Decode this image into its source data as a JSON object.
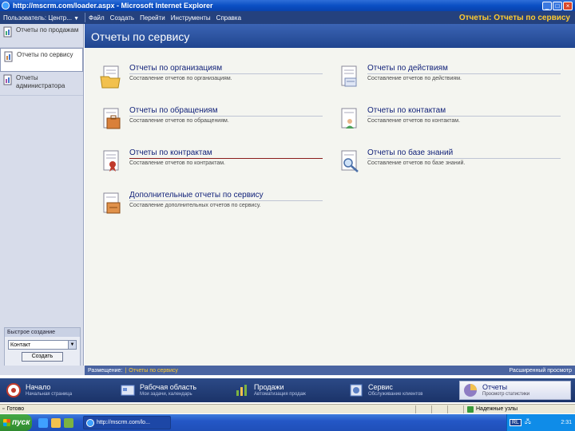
{
  "window": {
    "title": "http://mscrm.com/loader.aspx - Microsoft Internet Explorer",
    "btn_min": "_",
    "btn_max": "□",
    "btn_close": "×"
  },
  "appbar": {
    "user": "Пользователь: Центр...",
    "menu": [
      "Файл",
      "Создать",
      "Перейти",
      "Инструменты",
      "Справка"
    ],
    "section_title": "Отчеты: Отчеты по сервису"
  },
  "leftnav": {
    "items": [
      {
        "label": "Отчеты по продажам",
        "active": false
      },
      {
        "label": "Отчеты по сервису",
        "active": true
      },
      {
        "label": "Отчеты администратора",
        "active": false
      }
    ],
    "quick_create": {
      "title": "Быстрое создание",
      "selected": "Контакт",
      "button": "Создать"
    }
  },
  "main": {
    "header": "Отчеты по сервису",
    "reports": [
      {
        "title": "Отчеты по организациям",
        "desc": "Составление отчетов по организациям.",
        "hot": false
      },
      {
        "title": "Отчеты по действиям",
        "desc": "Составление отчетов по действиям.",
        "hot": false
      },
      {
        "title": "Отчеты по обращениям",
        "desc": "Составление отчетов по обращениям.",
        "hot": false
      },
      {
        "title": "Отчеты по контактам",
        "desc": "Составление отчетов по контактам.",
        "hot": false
      },
      {
        "title": "Отчеты по контрактам",
        "desc": "Составление отчетов по контрактам.",
        "hot": true
      },
      {
        "title": "Отчеты по базе знаний",
        "desc": "Составление отчетов по базе знаний.",
        "hot": false
      },
      {
        "title": "Дополнительные отчеты по сервису",
        "desc": "Составление дополнительных отчетов по сервису.",
        "hot": false
      }
    ]
  },
  "strip": {
    "location_label": "Размещение:",
    "separator": "|",
    "location_value": "Отчеты по сервису",
    "advanced": "Расширенный просмотр"
  },
  "modules": [
    {
      "title": "Начало",
      "sub": "Начальная страница",
      "active": false,
      "color": "#c0392b"
    },
    {
      "title": "Рабочая область",
      "sub": "Мои задачи, календарь",
      "active": false,
      "color": "#6c8fd6"
    },
    {
      "title": "Продажи",
      "sub": "Автоматизация продаж",
      "active": false,
      "color": "#7cb342"
    },
    {
      "title": "Сервис",
      "sub": "Обслуживание клиентов",
      "active": false,
      "color": "#5a7fc4"
    },
    {
      "title": "Отчеты",
      "sub": "Просмотр статистики",
      "active": true,
      "color": "#8e7cc3"
    }
  ],
  "iestatus": {
    "text": "Готово",
    "zone": "Надежные узлы"
  },
  "taskbar": {
    "start": "пуск",
    "task": "http://mscrm.com/lo...",
    "lang": "RL",
    "clock": "2:31"
  }
}
